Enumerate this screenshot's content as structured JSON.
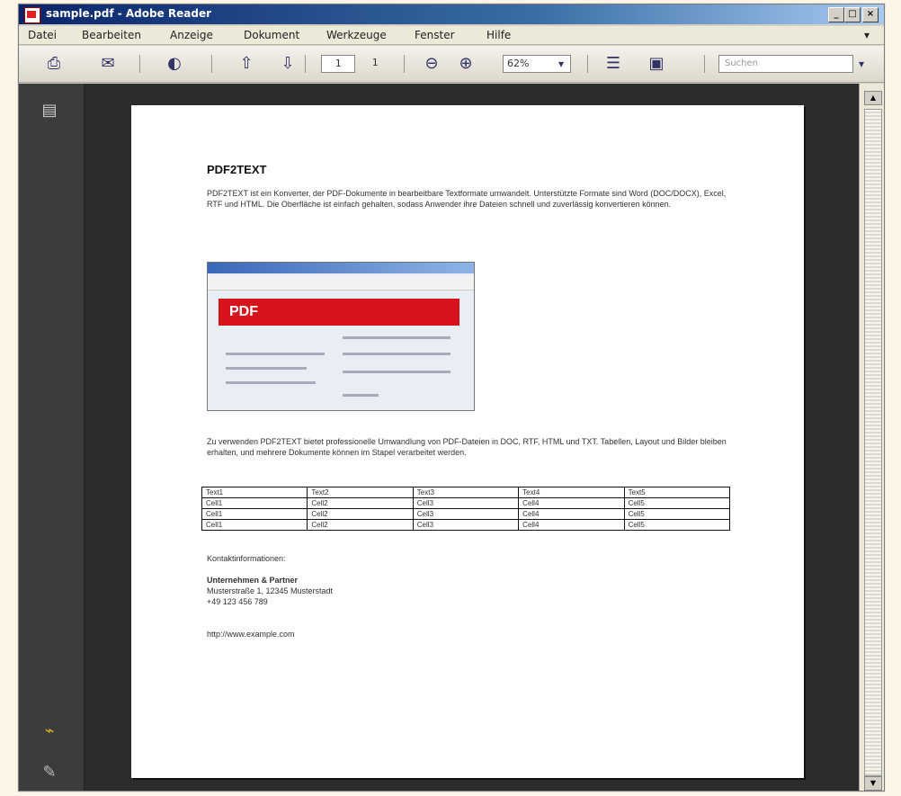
{
  "window": {
    "title": "sample.pdf - Adobe Reader"
  },
  "menu": [
    "Datei",
    "Bearbeiten",
    "Anzeige",
    "Dokument",
    "Werkzeuge",
    "Fenster",
    "Hilfe"
  ],
  "toolbar": {
    "page_current": "1",
    "page_total": "1",
    "zoom": "62%",
    "find_placeholder": "Suchen"
  },
  "document": {
    "title": "PDF2TEXT",
    "intro": "PDF2TEXT ist ein Konverter, der PDF-Dokumente in bearbeitbare Textformate umwandelt. Unterstützte Formate sind Word (DOC/DOCX), Excel, RTF und HTML. Die Oberfläche ist einfach gehalten, sodass Anwender ihre Dateien schnell und zuverlässig konvertieren können.",
    "screenshot_logo": "PDF",
    "body": "Zu verwenden PDF2TEXT bietet professionelle Umwandlung von PDF-Dateien in DOC, RTF, HTML und TXT. Tabellen, Layout und Bilder bleiben erhalten, und mehrere Dokumente können im Stapel verarbeitet werden.",
    "table": {
      "headers": [
        "Text1",
        "Text2",
        "Text3",
        "Text4",
        "Text5"
      ],
      "rows": [
        [
          "Cell1",
          "Cell2",
          "Cell3",
          "Cell4",
          "Cell5"
        ],
        [
          "Cell1",
          "Cell2",
          "Cell3",
          "Cell4",
          "Cell5"
        ],
        [
          "Cell1",
          "Cell2",
          "Cell3",
          "Cell4",
          "Cell5"
        ]
      ]
    },
    "contact_heading": "Kontaktinformationen:",
    "contact_name": "Unternehmen & Partner",
    "contact_address": "Musterstraße 1, 12345 Musterstadt",
    "contact_phone": "+49 123 456 789",
    "url": "http://www.example.com"
  }
}
